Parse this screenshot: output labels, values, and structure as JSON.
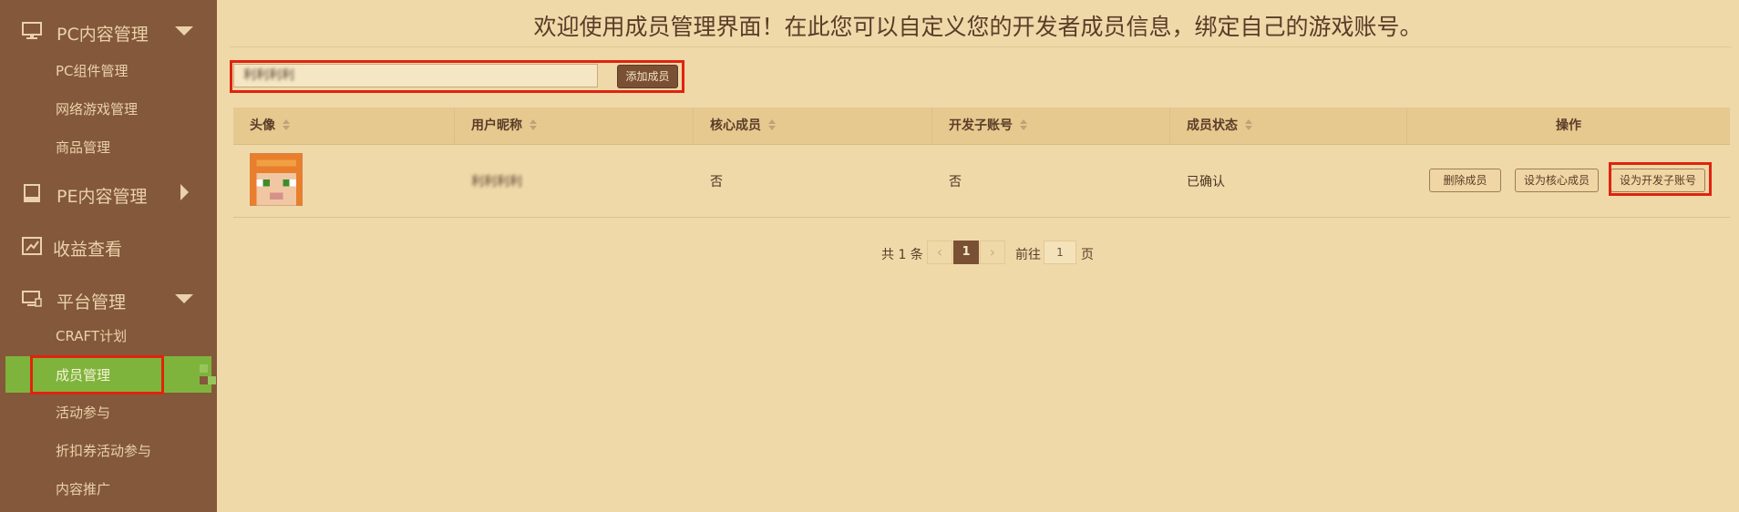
{
  "header": {
    "title": "欢迎使用成员管理界面！在此您可以自定义您的开发者成员信息，绑定自己的游戏账号。"
  },
  "sidebar": {
    "groups": [
      {
        "label": "PC内容管理",
        "icon": "monitor-icon",
        "expanded": true
      },
      {
        "label": "PE内容管理",
        "icon": "tablet-icon",
        "expanded": false
      },
      {
        "label": "收益查看",
        "icon": "chart-icon"
      },
      {
        "label": "平台管理",
        "icon": "platform-icon",
        "expanded": true
      }
    ],
    "pc_items": [
      "PC组件管理",
      "网络游戏管理",
      "商品管理"
    ],
    "platform_items": [
      "CRAFT计划",
      "成员管理",
      "活动参与",
      "折扣券活动参与",
      "内容推广"
    ],
    "active_item": "成员管理"
  },
  "add_member": {
    "input_value": "利利利利",
    "button_label": "添加成员"
  },
  "table": {
    "columns": [
      "头像",
      "用户昵称",
      "核心成员",
      "开发子账号",
      "成员状态",
      "操作"
    ],
    "rows": [
      {
        "nickname": "利利利利",
        "core_member": "否",
        "dev_sub_account": "否",
        "status": "已确认",
        "actions": [
          "删除成员",
          "设为核心成员",
          "设为开发子账号"
        ]
      }
    ]
  },
  "pagination": {
    "total_text": "共 1 条",
    "prev": "‹",
    "current_page": "1",
    "next": "›",
    "goto_label": "前往",
    "goto_value": "1",
    "page_suffix": "页"
  },
  "colors": {
    "sidebar_bg": "#84583a",
    "content_bg": "#efd9a9",
    "active_bg": "#7fb43c",
    "highlight": "#e0230f",
    "button_brown": "#7a5034"
  }
}
